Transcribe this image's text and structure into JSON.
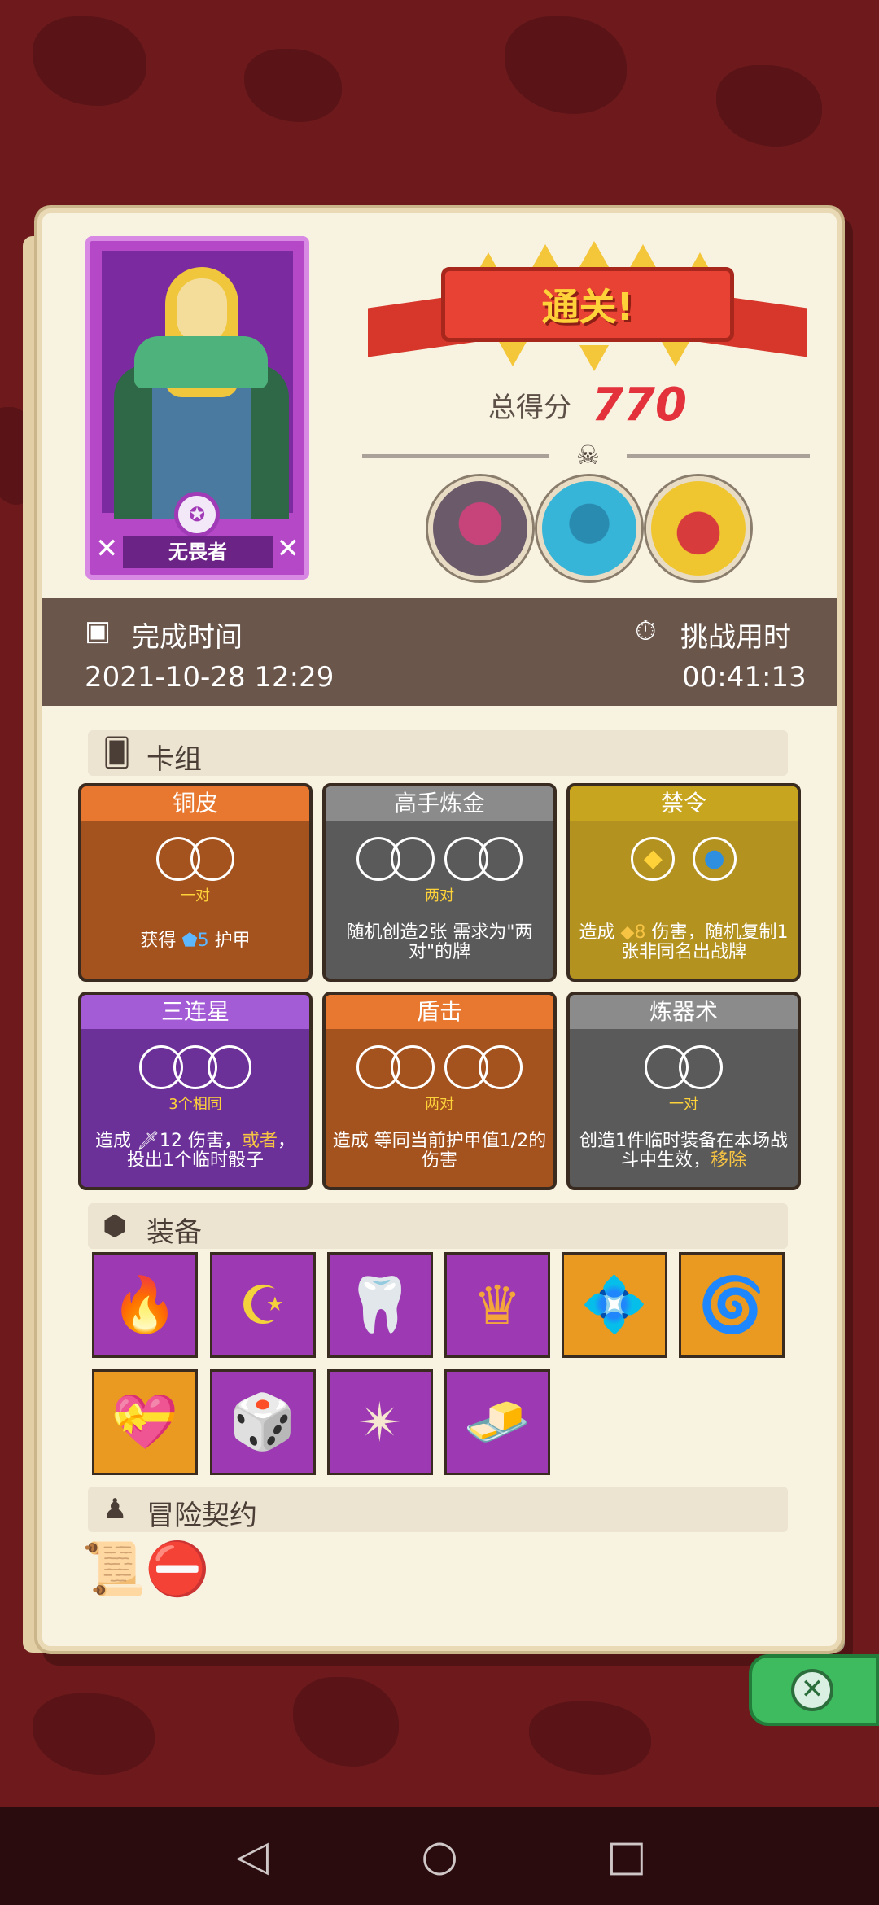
{
  "hero": {
    "name": "无畏者"
  },
  "result": {
    "banner": "通关!",
    "score_label": "总得分",
    "score_value": "770"
  },
  "info": {
    "finish_label": "完成时间",
    "finish_value": "2021-10-28 12:29",
    "duration_label": "挑战用时",
    "duration_value": "00:41:13"
  },
  "sections": {
    "deck": "卡组",
    "equipment": "装备",
    "contract": "冒险契约"
  },
  "deck": [
    {
      "title": "铜皮",
      "sub": "一对",
      "desc_a": "获得",
      "desc_b": "5",
      "desc_c": "护甲",
      "color": "#a4521e",
      "head": "#e8782f"
    },
    {
      "title": "高手炼金",
      "sub": "两对",
      "desc": "随机创造2张 需求为\"两对\"的牌",
      "color": "#5a5a5a",
      "head": "#8b8b8b"
    },
    {
      "title": "禁令",
      "sub": "",
      "desc_a": "造成",
      "desc_b": "8",
      "desc_c": "伤害，随机复制1张非同名出战牌",
      "color": "#b39220",
      "head": "#c7a51f"
    },
    {
      "title": "三连星",
      "sub": "3个相同",
      "desc_a": "造成",
      "desc_b": "12 伤害，",
      "desc_c": "或者",
      "desc_d": "，投出1个临时骰子",
      "color": "#6c3198",
      "head": "#a45bd6"
    },
    {
      "title": "盾击",
      "sub": "两对",
      "desc": "造成 等同当前护甲值1/2的伤害",
      "color": "#a4521e",
      "head": "#e8782f"
    },
    {
      "title": "炼器术",
      "sub": "一对",
      "desc_a": "创造1件临时装备在本场战斗中生效，",
      "desc_b": "移除",
      "color": "#5a5a5a",
      "head": "#8b8b8b"
    }
  ],
  "equipment": [
    {
      "icon": "fire-cup-icon",
      "glyph": "🔥",
      "bg": "#9c39b3"
    },
    {
      "icon": "moon-star-icon",
      "glyph": "☪",
      "bg": "#9c39b3"
    },
    {
      "icon": "claws-icon",
      "glyph": "🦷",
      "bg": "#9c39b3"
    },
    {
      "icon": "crown-icon",
      "glyph": "♛",
      "bg": "#9c39b3"
    },
    {
      "icon": "blue-skull-shield-icon",
      "glyph": "💠",
      "bg": "#ea9a21"
    },
    {
      "icon": "horn-icon",
      "glyph": "🌀",
      "bg": "#ea9a21"
    },
    {
      "icon": "heart-box-icon",
      "glyph": "💝",
      "bg": "#ea9a21"
    },
    {
      "icon": "broken-die-icon",
      "glyph": "🎲",
      "bg": "#9c39b3"
    },
    {
      "icon": "spiked-die-icon",
      "glyph": "✴",
      "bg": "#9c39b3"
    },
    {
      "icon": "gold-block-icon",
      "glyph": "🧈",
      "bg": "#9c39b3"
    }
  ],
  "contracts": [
    {
      "icon": "scroll-icon",
      "glyph": "📜"
    },
    {
      "icon": "demon-seal-icon",
      "glyph": "⛔"
    }
  ]
}
